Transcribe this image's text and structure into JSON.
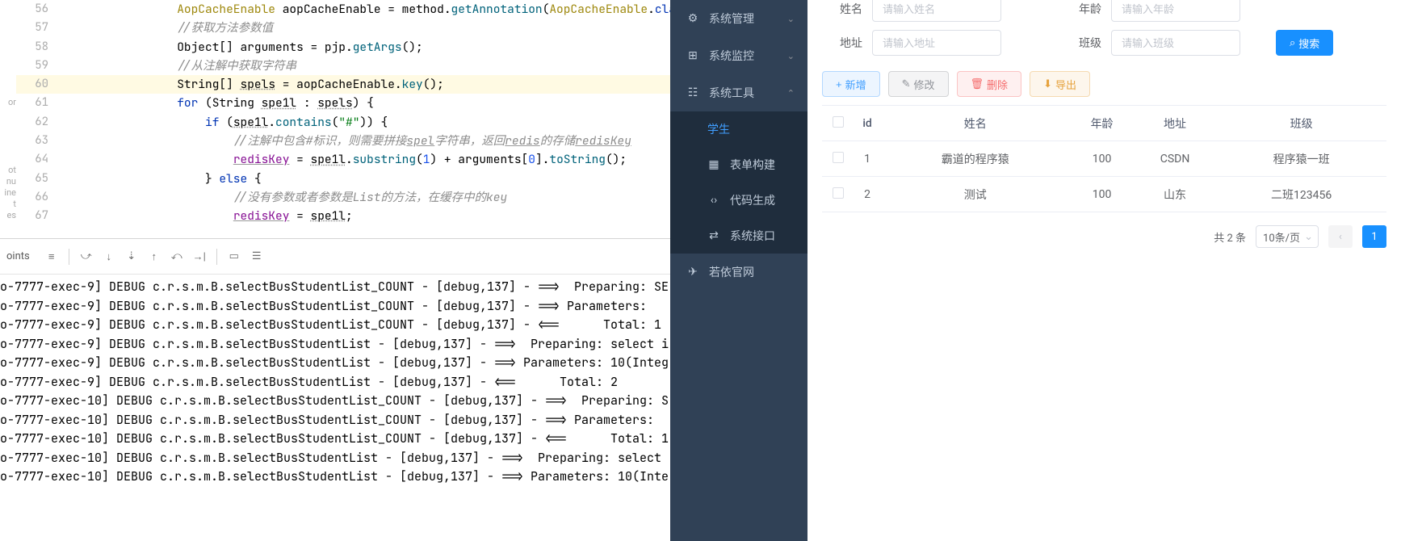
{
  "code": {
    "lines": [
      {
        "n": "56",
        "indent": 4,
        "segs": [
          {
            "t": "AopCacheEnable",
            "c": "anno"
          },
          {
            "t": " aopCacheEnable = method.",
            "c": "ident"
          },
          {
            "t": "getAnnotation",
            "c": "method"
          },
          {
            "t": "(",
            "c": "ident"
          },
          {
            "t": "AopCacheEnable",
            "c": "anno"
          },
          {
            "t": ".",
            "c": "ident"
          },
          {
            "t": "class",
            "c": "kw"
          }
        ]
      },
      {
        "n": "57",
        "indent": 4,
        "segs": [
          {
            "t": "//获取方法参数值",
            "c": "comment"
          }
        ]
      },
      {
        "n": "58",
        "indent": 4,
        "segs": [
          {
            "t": "Object[] arguments = pjp.",
            "c": "ident"
          },
          {
            "t": "getArgs",
            "c": "method"
          },
          {
            "t": "();",
            "c": "ident"
          }
        ]
      },
      {
        "n": "59",
        "indent": 4,
        "segs": [
          {
            "t": "//从注解中获取字符串",
            "c": "comment"
          }
        ]
      },
      {
        "n": "60",
        "indent": 4,
        "highlight": true,
        "segs": [
          {
            "t": "String[] ",
            "c": "ident"
          },
          {
            "t": "spels",
            "c": "ident wavy"
          },
          {
            "t": " = aopCacheEnable.",
            "c": "ident"
          },
          {
            "t": "key",
            "c": "method"
          },
          {
            "t": "();",
            "c": "ident"
          }
        ]
      },
      {
        "n": "61",
        "indent": 4,
        "segs": [
          {
            "t": "for ",
            "c": "kw"
          },
          {
            "t": "(String ",
            "c": "ident"
          },
          {
            "t": "spe1l",
            "c": "ident wavy"
          },
          {
            "t": " : ",
            "c": "ident"
          },
          {
            "t": "spels",
            "c": "ident wavy"
          },
          {
            "t": ") {",
            "c": "ident"
          }
        ]
      },
      {
        "n": "62",
        "indent": 5,
        "segs": [
          {
            "t": "if ",
            "c": "kw"
          },
          {
            "t": "(",
            "c": "ident"
          },
          {
            "t": "spe1l",
            "c": "ident wavy"
          },
          {
            "t": ".",
            "c": "ident"
          },
          {
            "t": "contains",
            "c": "method"
          },
          {
            "t": "(",
            "c": "ident"
          },
          {
            "t": "\"#\"",
            "c": "str"
          },
          {
            "t": ")) {",
            "c": "ident"
          }
        ]
      },
      {
        "n": "63",
        "indent": 6,
        "segs": [
          {
            "t": "//注解中包含#标识，则需要拼接",
            "c": "comment"
          },
          {
            "t": "spel",
            "c": "comment underline"
          },
          {
            "t": "字符串，返回",
            "c": "comment"
          },
          {
            "t": "redis",
            "c": "comment underline"
          },
          {
            "t": "的存储",
            "c": "comment"
          },
          {
            "t": "redisKey",
            "c": "comment underline"
          }
        ]
      },
      {
        "n": "64",
        "indent": 6,
        "segs": [
          {
            "t": "redisKey",
            "c": "field underline"
          },
          {
            "t": " = ",
            "c": "ident"
          },
          {
            "t": "spe1l",
            "c": "ident wavy"
          },
          {
            "t": ".",
            "c": "ident"
          },
          {
            "t": "substring",
            "c": "method"
          },
          {
            "t": "(",
            "c": "ident"
          },
          {
            "t": "1",
            "c": "num"
          },
          {
            "t": ") + arguments[",
            "c": "ident"
          },
          {
            "t": "0",
            "c": "num"
          },
          {
            "t": "].",
            "c": "ident"
          },
          {
            "t": "toString",
            "c": "method"
          },
          {
            "t": "();",
            "c": "ident"
          }
        ]
      },
      {
        "n": "65",
        "indent": 5,
        "segs": [
          {
            "t": "} ",
            "c": "ident"
          },
          {
            "t": "else ",
            "c": "kw"
          },
          {
            "t": "{",
            "c": "ident"
          }
        ]
      },
      {
        "n": "66",
        "indent": 6,
        "segs": [
          {
            "t": "//没有参数或者参数是List的方法，在缓存中的key",
            "c": "comment"
          }
        ]
      },
      {
        "n": "67",
        "indent": 6,
        "segs": [
          {
            "t": "redisKey",
            "c": "field underline"
          },
          {
            "t": " = ",
            "c": "ident"
          },
          {
            "t": "spe1l",
            "c": "ident wavy"
          },
          {
            "t": ";",
            "c": "ident"
          }
        ]
      }
    ]
  },
  "left_stub": [
    "or",
    "",
    "",
    "",
    "",
    "",
    "ot",
    "nu",
    "ine",
    "t",
    "es"
  ],
  "debug": {
    "tab": "oints",
    "console": [
      "o-7777-exec-9] DEBUG c.r.s.m.B.selectBusStudentList_COUNT - [debug,137] - ==>  Preparing: SE",
      "o-7777-exec-9] DEBUG c.r.s.m.B.selectBusStudentList_COUNT - [debug,137] - ==> Parameters: ",
      "o-7777-exec-9] DEBUG c.r.s.m.B.selectBusStudentList_COUNT - [debug,137] - <==      Total: 1",
      "o-7777-exec-9] DEBUG c.r.s.m.B.selectBusStudentList - [debug,137] - ==>  Preparing: select i",
      "o-7777-exec-9] DEBUG c.r.s.m.B.selectBusStudentList - [debug,137] - ==> Parameters: 10(Integ",
      "o-7777-exec-9] DEBUG c.r.s.m.B.selectBusStudentList - [debug,137] - <==      Total: 2",
      "o-7777-exec-10] DEBUG c.r.s.m.B.selectBusStudentList_COUNT - [debug,137] - ==>  Preparing: S",
      "o-7777-exec-10] DEBUG c.r.s.m.B.selectBusStudentList_COUNT - [debug,137] - ==> Parameters: ",
      "o-7777-exec-10] DEBUG c.r.s.m.B.selectBusStudentList_COUNT - [debug,137] - <==      Total: 1",
      "o-7777-exec-10] DEBUG c.r.s.m.B.selectBusStudentList - [debug,137] - ==>  Preparing: select ",
      "o-7777-exec-10] DEBUG c.r.s.m.B.selectBusStudentList - [debug,137] - ==> Parameters: 10(Inte"
    ]
  },
  "sidebar": {
    "items": [
      {
        "icon": "⚙",
        "label": "系统管理",
        "arrow": "⌄"
      },
      {
        "icon": "⊞",
        "label": "系统监控",
        "arrow": "⌄"
      },
      {
        "icon": "☷",
        "label": "系统工具",
        "arrow": "⌃",
        "expanded": true,
        "children": [
          {
            "label": "学生",
            "active": true
          },
          {
            "icon": "▦",
            "label": "表单构建"
          },
          {
            "icon": "‹›",
            "label": "代码生成"
          },
          {
            "icon": "⇄",
            "label": "系统接口"
          }
        ]
      },
      {
        "icon": "✈",
        "label": "若依官网"
      }
    ]
  },
  "form": {
    "name_label": "姓名",
    "name_ph": "请输入姓名",
    "age_label": "年龄",
    "age_ph": "请输入年龄",
    "addr_label": "地址",
    "addr_ph": "请输入地址",
    "class_label": "班级",
    "class_ph": "请输入班级",
    "search_label": "搜索"
  },
  "actions": {
    "add": "新增",
    "edit": "修改",
    "del": "删除",
    "export": "导出"
  },
  "table": {
    "headers": [
      "id",
      "姓名",
      "年龄",
      "地址",
      "班级"
    ],
    "rows": [
      {
        "id": "1",
        "name": "霸道的程序猿",
        "age": "100",
        "addr": "CSDN",
        "class": "程序猿一班"
      },
      {
        "id": "2",
        "name": "测试",
        "age": "100",
        "addr": "山东",
        "class": "二班123456"
      }
    ]
  },
  "pager": {
    "total": "共 2 条",
    "page_size": "10条/页",
    "current": "1"
  }
}
